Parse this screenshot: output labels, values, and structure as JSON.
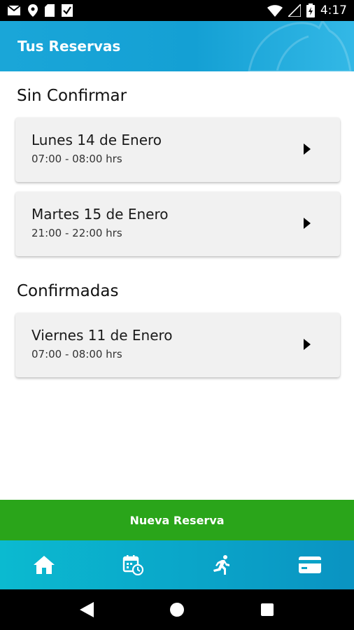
{
  "status_bar": {
    "time": "4:17",
    "icons": [
      "gmail-icon",
      "location-icon",
      "sd-card-icon",
      "app-icon",
      "wifi-icon",
      "no-signal-icon",
      "battery-icon"
    ]
  },
  "header": {
    "title": "Tus Reservas"
  },
  "sections": [
    {
      "title": "Sin Confirmar",
      "items": [
        {
          "date": "Lunes 14 de Enero",
          "time": "07:00 - 08:00 hrs"
        },
        {
          "date": "Martes 15 de Enero",
          "time": "21:00 - 22:00 hrs"
        }
      ]
    },
    {
      "title": "Confirmadas",
      "items": [
        {
          "date": "Viernes 11 de Enero",
          "time": "07:00 - 08:00 hrs"
        }
      ]
    }
  ],
  "actions": {
    "new_reservation": "Nueva Reserva"
  },
  "bottom_nav": {
    "items": [
      "home-icon",
      "calendar-clock-icon",
      "running-icon",
      "credit-card-icon"
    ]
  },
  "colors": {
    "header": "#14a0d4",
    "new_button": "#2aa51a",
    "bottom_nav": "#0aa3c8",
    "card": "#f1f1f1"
  }
}
